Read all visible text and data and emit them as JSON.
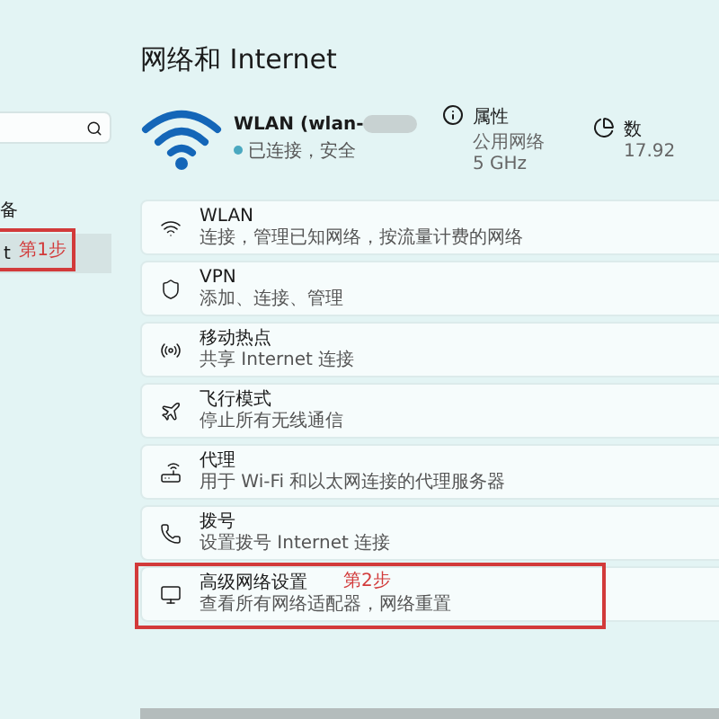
{
  "sidebar": {
    "section_label": "备",
    "items": [
      {
        "label": "t",
        "selected": true,
        "annotation": "第1步"
      }
    ]
  },
  "title": "网络和 Internet",
  "connection": {
    "name": "WLAN (wlan-",
    "status": "已连接，安全",
    "properties": {
      "title": "属性",
      "lines": [
        "公用网络",
        "5 GHz"
      ]
    },
    "data_usage": {
      "title": "数",
      "lines": [
        "17.92"
      ]
    }
  },
  "rows": [
    {
      "title": "WLAN",
      "subtitle": "连接，管理已知网络，按流量计费的网络"
    },
    {
      "title": "VPN",
      "subtitle": "添加、连接、管理"
    },
    {
      "title": "移动热点",
      "subtitle": "共享 Internet 连接"
    },
    {
      "title": "飞行模式",
      "subtitle": "停止所有无线通信"
    },
    {
      "title": "代理",
      "subtitle": "用于 Wi-Fi 和以太网连接的代理服务器"
    },
    {
      "title": "拨号",
      "subtitle": "设置拨号 Internet 连接"
    },
    {
      "title": "高级网络设置",
      "subtitle": "查看所有网络适配器，网络重置",
      "annotation": "第2步"
    }
  ]
}
